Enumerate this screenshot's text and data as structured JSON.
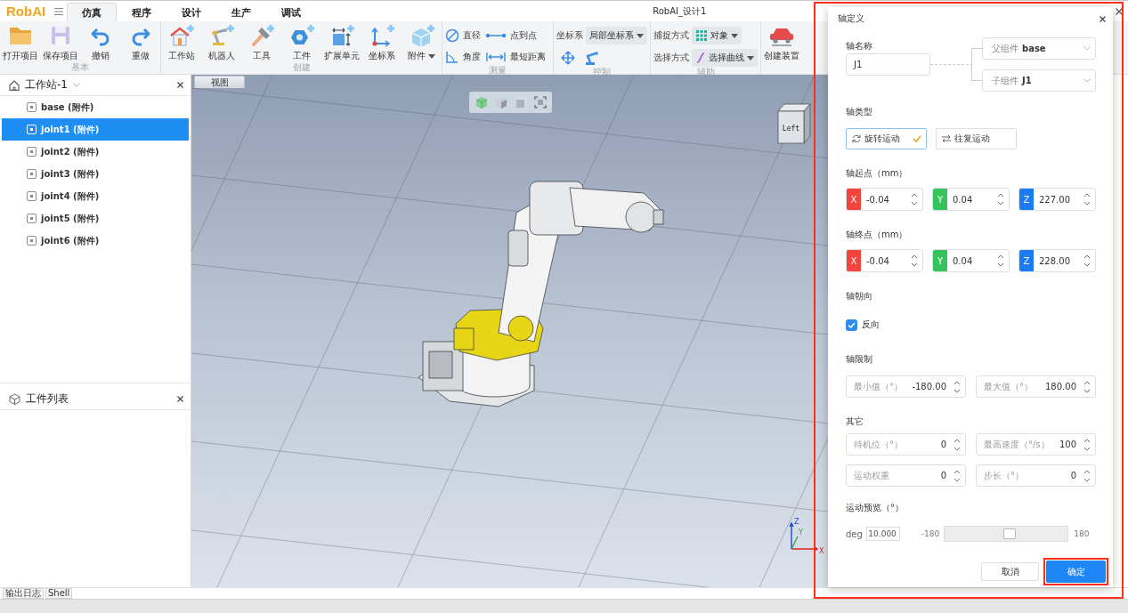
{
  "app": {
    "logo": "RobAI",
    "title": "RobAI_设计1"
  },
  "menu_tabs": [
    {
      "label": "仿真",
      "selected": true
    },
    {
      "label": "程序",
      "selected": false
    },
    {
      "label": "设计",
      "selected": false
    },
    {
      "label": "生产",
      "selected": false
    },
    {
      "label": "调试",
      "selected": false
    }
  ],
  "ribbon": [
    {
      "label": "基本",
      "rows": [
        [
          {
            "kind": "large",
            "label": "打开项目"
          },
          {
            "kind": "large",
            "label": "保存项目"
          },
          {
            "kind": "large",
            "label": "撤销"
          },
          {
            "kind": "large",
            "label": "重做"
          }
        ]
      ]
    },
    {
      "label": "创建",
      "rows": [
        [
          {
            "kind": "large",
            "label": "工作站"
          },
          {
            "kind": "large",
            "label": "机器人"
          },
          {
            "kind": "large",
            "label": "工具"
          },
          {
            "kind": "large",
            "label": "工件"
          },
          {
            "kind": "large",
            "label": "扩展单元"
          },
          {
            "kind": "large",
            "label": "坐标系"
          },
          {
            "kind": "large-menu",
            "label": "附件"
          }
        ]
      ]
    },
    {
      "label": "测量",
      "rows": [
        [
          {
            "kind": "small",
            "label": "直径"
          },
          {
            "kind": "small",
            "label": "点到点"
          }
        ],
        [
          {
            "kind": "small",
            "label": "角度"
          },
          {
            "kind": "small",
            "label": "最短距离"
          }
        ]
      ]
    },
    {
      "label": "控制",
      "rows": [
        [
          {
            "kind": "select",
            "label": "坐标系",
            "value": "局部坐标系"
          }
        ],
        [
          {
            "kind": "icon"
          },
          {
            "kind": "icon"
          }
        ]
      ]
    },
    {
      "label": "辅助",
      "rows": [
        [
          {
            "kind": "select",
            "label": "捕捉方式",
            "value": "对象"
          }
        ],
        [
          {
            "kind": "select",
            "label": "选择方式",
            "value": "选择曲线"
          }
        ]
      ]
    },
    {
      "rows": [
        [
          {
            "kind": "large",
            "label": "创建装置"
          }
        ]
      ]
    }
  ],
  "workstation_panel": {
    "title": "工作站-1",
    "items": [
      {
        "label": "base (附件)",
        "selected": false
      },
      {
        "label": "joint1 (附件)",
        "selected": true
      },
      {
        "label": "joint2 (附件)",
        "selected": false
      },
      {
        "label": "joint3 (附件)",
        "selected": false
      },
      {
        "label": "joint4 (附件)",
        "selected": false
      },
      {
        "label": "joint5 (附件)",
        "selected": false
      },
      {
        "label": "joint6 (附件)",
        "selected": false
      }
    ]
  },
  "parts_panel": {
    "title": "工件列表"
  },
  "viewport": {
    "tab": "视图",
    "view_cube": "Left",
    "axis_labels": [
      "Z",
      "Y",
      "X"
    ]
  },
  "bottom_tabs": [
    "输出日志",
    "Shell"
  ],
  "dialog": {
    "highlighted": true,
    "title": "轴定义",
    "name_field": {
      "label": "轴名称",
      "value": "J1"
    },
    "links": [
      {
        "label": "父组件",
        "value": "base"
      },
      {
        "label": "子组件",
        "value": "J1"
      }
    ],
    "axis_type": {
      "label": "轴类型",
      "options": [
        {
          "label": "旋转运动",
          "selected": true
        },
        {
          "label": "往复运动",
          "selected": false
        }
      ]
    },
    "start_point": {
      "label": "轴起点（mm）",
      "fields": [
        {
          "axis": "X",
          "color": "#f5443b",
          "value": "-0.04"
        },
        {
          "axis": "Y",
          "color": "#37c35b",
          "value": "0.04"
        },
        {
          "axis": "Z",
          "color": "#1a7cf5",
          "value": "227.00"
        }
      ]
    },
    "end_point": {
      "label": "轴终点（mm）",
      "fields": [
        {
          "axis": "X",
          "color": "#f5443b",
          "value": "-0.04"
        },
        {
          "axis": "Y",
          "color": "#37c35b",
          "value": "0.04"
        },
        {
          "axis": "Z",
          "color": "#1a7cf5",
          "value": "228.00"
        }
      ]
    },
    "orientation": {
      "label": "轴朝向",
      "options": [
        {
          "label": "反向",
          "checked": true
        }
      ]
    },
    "limits": {
      "label": "轴限制",
      "fields": [
        {
          "label": "最小值（°）",
          "value": "-180.00"
        },
        {
          "label": "最大值（°）",
          "value": "180.00"
        }
      ]
    },
    "other": {
      "label": "其它",
      "fields": [
        {
          "label": "待机位（°）",
          "value": "0"
        },
        {
          "label": "最高速度（°/s）",
          "value": "100"
        },
        {
          "label": "运动权重",
          "value": "0"
        },
        {
          "label": "步长（°）",
          "value": "0"
        }
      ]
    },
    "preview": {
      "label": "运动预览（°）",
      "unit": "deg",
      "value": "10.000",
      "min": "-180",
      "max": "180",
      "level": 0.53
    },
    "buttons": [
      {
        "label": "取消",
        "kind": "secondary",
        "highlighted": false
      },
      {
        "label": "确定",
        "kind": "primary",
        "highlighted": true
      }
    ]
  }
}
